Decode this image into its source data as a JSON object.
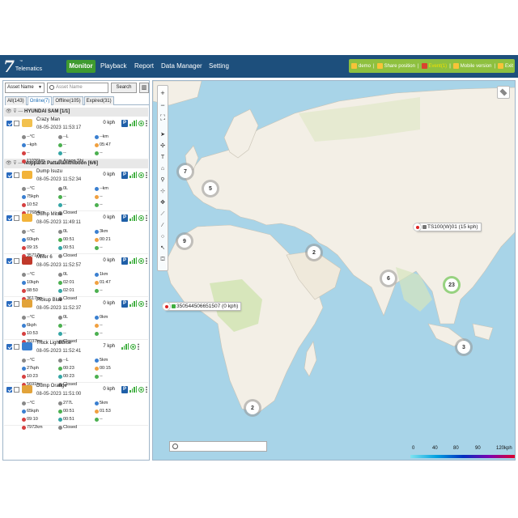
{
  "brand": {
    "logo_number": "7",
    "logo_text": "Telematics",
    "logo_tm": "™"
  },
  "nav": {
    "monitor": "Monitor",
    "playback": "Playback",
    "report": "Report",
    "data_manager": "Data Manager",
    "setting": "Setting"
  },
  "userbar": {
    "user": "demo",
    "share": "Share position",
    "events": "Event(1)",
    "mobile": "Mobile version",
    "exit": "Exit"
  },
  "search": {
    "select_value": "Asset Name",
    "placeholder": "Asset Name",
    "button": "Search"
  },
  "tabs": [
    "All(143)",
    "Online(7)",
    "Offline(105)",
    "Expired(31)"
  ],
  "groups": [
    {
      "title": "HYUNDAI SAM [1/1]"
    },
    {
      "title": "Nopparat Pattananithiboon [6/6]"
    }
  ],
  "devices": [
    {
      "name": "Crazy Man",
      "time": "08-05-2023 11:53:17",
      "speed": "0 kph",
      "fields": [
        "--°C",
        "--L",
        "--km",
        "--kph",
        "--",
        "05:47",
        "--",
        "--",
        "--",
        "11036km",
        "Anson Shi",
        ""
      ]
    },
    {
      "name": "Dump Isuzu",
      "time": "08-05-2023 11:52:34",
      "speed": "0 kph",
      "fields": [
        "--°C",
        "0L",
        "--km",
        "75kph",
        "--",
        "--",
        "10:52",
        "--",
        "--",
        "77684km",
        "Closed",
        ""
      ]
    },
    {
      "name": "Dump Mitsu",
      "time": "08-05-2023 11:49:11",
      "speed": "0 kph",
      "fields": [
        "--°C",
        "0L",
        "3km",
        "60kph",
        "00:51",
        "00:21",
        "09:15",
        "00:51",
        "--",
        "35717km",
        "Closed",
        ""
      ]
    },
    {
      "name": "Mixer 6",
      "time": "08-05-2023 11:52:57",
      "speed": "0 kph",
      "fields": [
        "--°C",
        "0L",
        "1km",
        "10kph",
        "02:01",
        "01:47",
        "08:50",
        "02:01",
        "--",
        "3617km",
        "Closed",
        ""
      ]
    },
    {
      "name": "Pickup Blue",
      "time": "08-05-2023 11:52:37",
      "speed": "0 kph",
      "fields": [
        "--°C",
        "0L",
        "0km",
        "6kph",
        "--",
        "--",
        "10:53",
        "--",
        "--",
        "3037km",
        "Closed",
        ""
      ]
    },
    {
      "name": "Truck Light Blue",
      "time": "08-05-2023 11:52:41",
      "speed": "7 kph",
      "fields": [
        "--°C",
        "--L",
        "5km",
        "27kph",
        "00:23",
        "00:15",
        "10:23",
        "00:23",
        "--",
        "5691km",
        "Closed",
        ""
      ]
    },
    {
      "name": "Dump Orange",
      "time": "08-05-2023 11:51:00",
      "speed": "0 kph",
      "fields": [
        "--°C",
        "277L",
        "5km",
        "65kph",
        "00:51",
        "01:53",
        "09:10",
        "00:51",
        "--",
        "7972km",
        "Closed",
        ""
      ]
    }
  ],
  "map": {
    "clusters": [
      {
        "count": "7"
      },
      {
        "count": "5"
      },
      {
        "count": "9"
      },
      {
        "count": "2"
      },
      {
        "count": "6"
      },
      {
        "count": "23"
      },
      {
        "count": "3"
      },
      {
        "count": "2"
      }
    ],
    "labels": {
      "ts100": "TS100(W)01 (15 kph)",
      "imei": "350544506651507 (0 kph)"
    },
    "legend": [
      "0",
      "40",
      "80",
      "90",
      "120kph"
    ]
  },
  "colors": {
    "header": "#1d4f7c",
    "accent": "#3f9b2f",
    "userbar": "#8ec03f",
    "sea": "#a8d4e8",
    "land": "#f3efe6"
  }
}
